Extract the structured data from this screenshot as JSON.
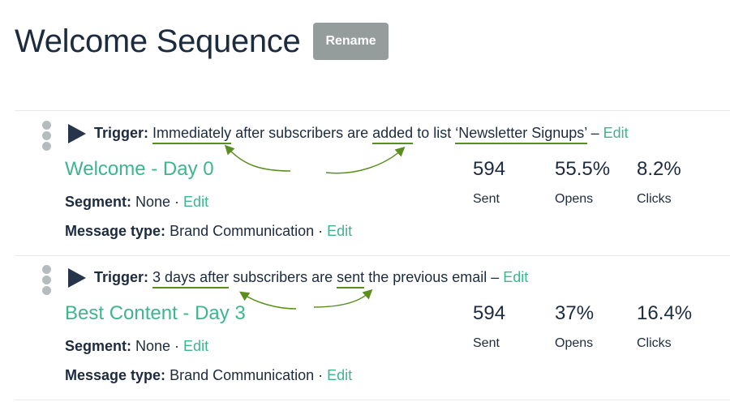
{
  "header": {
    "title": "Welcome Sequence",
    "rename_label": "Rename"
  },
  "colors": {
    "accent": "#3fb58c",
    "text": "#1d2b3f",
    "button_bg": "#959d9c",
    "annotation": "#5a8f1e"
  },
  "emails": [
    {
      "trigger_label": "Trigger:",
      "trigger_parts": [
        "Immediately",
        " after subscribers are ",
        "added",
        " to list ",
        "‘Newsletter Signups’",
        " – "
      ],
      "trigger_edit": "Edit",
      "name": "Welcome - Day 0",
      "segment_label": "Segment:",
      "segment_value": " None · ",
      "segment_edit": "Edit",
      "message_type_label": "Message type:",
      "message_type_value": " Brand Communication · ",
      "message_type_edit": "Edit",
      "stats": [
        {
          "value": "594",
          "label": "Sent"
        },
        {
          "value": "55.5%",
          "label": "Opens"
        },
        {
          "value": "8.2%",
          "label": "Clicks"
        }
      ]
    },
    {
      "trigger_label": "Trigger:",
      "trigger_parts": [
        "3 days after",
        " subscribers are ",
        "sent",
        " the previous email – "
      ],
      "trigger_edit": "Edit",
      "name": "Best Content - Day 3",
      "segment_label": "Segment:",
      "segment_value": " None · ",
      "segment_edit": "Edit",
      "message_type_label": "Message type:",
      "message_type_value": " Brand Communication · ",
      "message_type_edit": "Edit",
      "stats": [
        {
          "value": "594",
          "label": "Sent"
        },
        {
          "value": "37%",
          "label": "Opens"
        },
        {
          "value": "16.4%",
          "label": "Clicks"
        }
      ]
    }
  ]
}
